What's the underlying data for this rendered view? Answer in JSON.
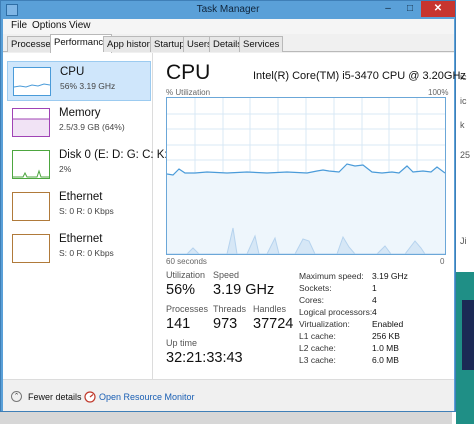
{
  "window": {
    "title": "Task Manager",
    "close_glyph": "✕",
    "min_glyph": "–",
    "max_glyph": "□"
  },
  "menu": [
    "File",
    "Options",
    "View"
  ],
  "tabs": [
    "Processes",
    "Performance",
    "App history",
    "Startup",
    "Users",
    "Details",
    "Services"
  ],
  "active_tab": "Performance",
  "sidebar": [
    {
      "title": "CPU",
      "sub": "56%  3.19 GHz",
      "color": "#4a9bd9",
      "selected": true
    },
    {
      "title": "Memory",
      "sub": "2.5/3.9 GB (64%)",
      "color": "#a043b5",
      "selected": false
    },
    {
      "title": "Disk 0 (E: D: G: C: K:",
      "sub": "2%",
      "color": "#4da63f",
      "selected": false
    },
    {
      "title": "Ethernet",
      "sub": "S: 0  R: 0 Kbps",
      "color": "#b07a3a",
      "selected": false
    },
    {
      "title": "Ethernet",
      "sub": "S: 0  R: 0 Kbps",
      "color": "#b07a3a",
      "selected": false
    }
  ],
  "cpu": {
    "heading": "CPU",
    "model": "Intel(R) Core(TM) i5-3470 CPU @ 3.20GHz",
    "util_label": "% Utilization",
    "max_label": "100%",
    "time_label": "60 seconds",
    "zero_label": "0",
    "stats": {
      "utilization_label": "Utilization",
      "utilization": "56%",
      "speed_label": "Speed",
      "speed": "3.19 GHz",
      "processes_label": "Processes",
      "processes": "141",
      "threads_label": "Threads",
      "threads": "973",
      "handles_label": "Handles",
      "handles": "37724",
      "uptime_label": "Up time",
      "uptime": "32:21:33:43"
    },
    "specs": [
      {
        "label": "Maximum speed:",
        "value": "3.19 GHz"
      },
      {
        "label": "Sockets:",
        "value": "1"
      },
      {
        "label": "Cores:",
        "value": "4"
      },
      {
        "label": "Logical processors:",
        "value": "4"
      },
      {
        "label": "Virtualization:",
        "value": "Enabled"
      },
      {
        "label": "L1 cache:",
        "value": "256 KB"
      },
      {
        "label": "L2 cache:",
        "value": "1.0 MB"
      },
      {
        "label": "L3 cache:",
        "value": "6.0 MB"
      }
    ]
  },
  "footer": {
    "fewer_details": "Fewer details",
    "open_resource_monitor": "Open Resource Monitor"
  },
  "background_fragments": [
    "ic",
    "ic",
    "k",
    "25",
    "Ji"
  ]
}
